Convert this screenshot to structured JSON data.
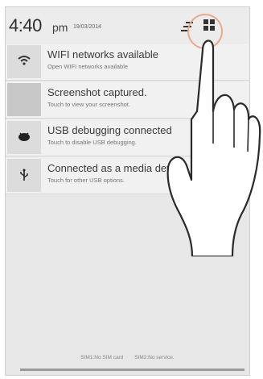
{
  "status": {
    "time": "4:40",
    "ampm": "pm",
    "date": "19/03/2014"
  },
  "notifications": [
    {
      "icon": "wifi-icon",
      "title": "WIFI networks available",
      "subtitle": "Open WIFI networks available"
    },
    {
      "icon": "screenshot-thumbnail",
      "title": "Screenshot captured.",
      "subtitle": "Touch to view your screenshot."
    },
    {
      "icon": "android-debug-icon",
      "title": "USB debugging connected",
      "subtitle": "Touch to disable USB debugging."
    },
    {
      "icon": "usb-icon",
      "title": "Connected as a media device",
      "subtitle": "Touch for other USB options."
    }
  ],
  "footer": {
    "sim1": "SIM1:No SIM card",
    "sim2": "SIM2:No service."
  },
  "colors": {
    "panel": "#e7e7e7",
    "highlight_ring": "#e9a98a"
  }
}
